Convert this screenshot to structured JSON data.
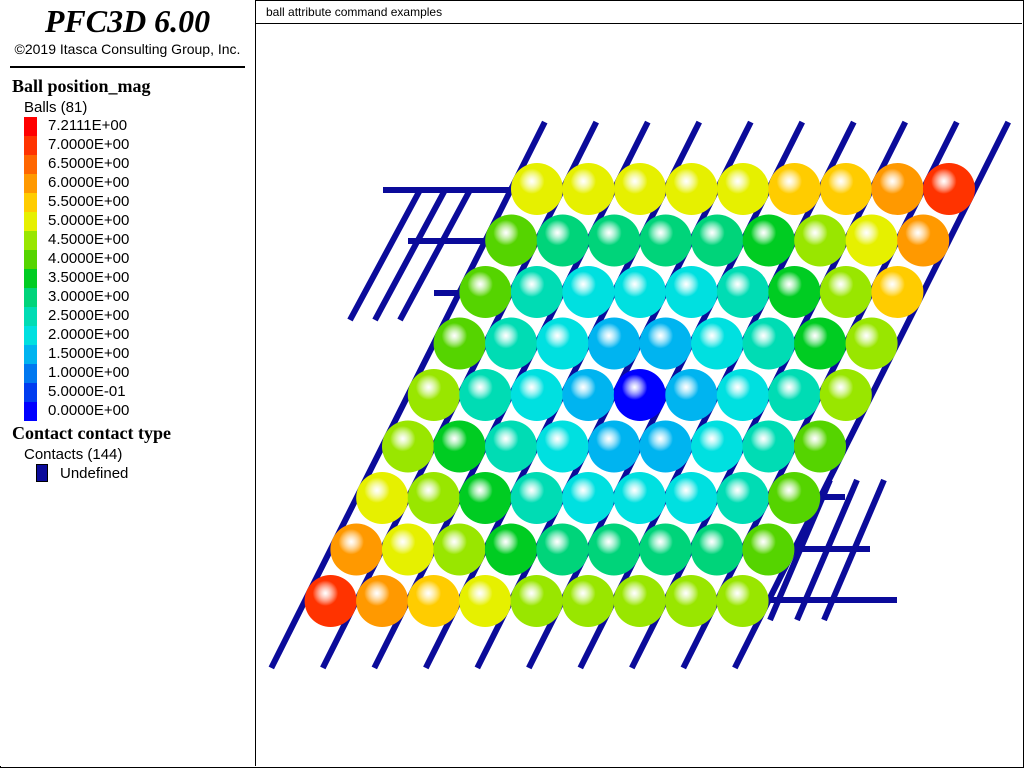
{
  "app": {
    "title": "PFC3D 6.00",
    "copyright": "©2019 Itasca Consulting Group, Inc."
  },
  "legend": {
    "ball_section": {
      "title": "Ball position_mag",
      "count_label": "Balls (81)",
      "color_entries": [
        {
          "label": "7.2111E+00",
          "color": "#ff0000"
        },
        {
          "label": "7.0000E+00",
          "color": "#ff3300"
        },
        {
          "label": "6.5000E+00",
          "color": "#ff6600"
        },
        {
          "label": "6.0000E+00",
          "color": "#ff9900"
        },
        {
          "label": "5.5000E+00",
          "color": "#ffcc00"
        },
        {
          "label": "5.0000E+00",
          "color": "#e6f000"
        },
        {
          "label": "4.5000E+00",
          "color": "#99e600"
        },
        {
          "label": "4.0000E+00",
          "color": "#55d400"
        },
        {
          "label": "3.5000E+00",
          "color": "#00cc22"
        },
        {
          "label": "3.0000E+00",
          "color": "#00d47a"
        },
        {
          "label": "2.5000E+00",
          "color": "#00dcb4"
        },
        {
          "label": "2.0000E+00",
          "color": "#00e0e0"
        },
        {
          "label": "1.5000E+00",
          "color": "#00b4f0"
        },
        {
          "label": "1.0000E+00",
          "color": "#0078f0"
        },
        {
          "label": "5.0000E-01",
          "color": "#003cf0"
        },
        {
          "label": "0.0000E+00",
          "color": "#0000ff"
        }
      ]
    },
    "contact_section": {
      "title": "Contact contact type",
      "count_label": "Contacts (144)",
      "entries": [
        {
          "label": "Undefined",
          "color": "#0b0b9a"
        }
      ]
    }
  },
  "plot": {
    "title": "ball attribute command examples",
    "ball_grid": {
      "rows": 9,
      "cols": 9,
      "position_mag": [
        [
          5.0,
          5.0,
          5.0,
          5.0,
          5.0,
          5.5,
          5.5,
          6.0,
          7.0
        ],
        [
          4.0,
          3.0,
          3.0,
          3.0,
          3.0,
          3.5,
          4.5,
          5.0,
          6.0
        ],
        [
          4.0,
          2.5,
          2.0,
          2.0,
          2.0,
          2.5,
          3.5,
          4.5,
          5.5
        ],
        [
          4.0,
          2.5,
          2.0,
          1.5,
          1.5,
          2.0,
          2.5,
          3.5,
          4.5
        ],
        [
          4.5,
          2.5,
          2.0,
          1.5,
          0.0,
          1.5,
          2.0,
          2.5,
          4.5
        ],
        [
          4.5,
          3.5,
          2.5,
          2.0,
          1.5,
          1.5,
          2.0,
          2.5,
          4.0
        ],
        [
          5.0,
          4.5,
          3.5,
          2.5,
          2.0,
          2.0,
          2.0,
          2.5,
          4.0
        ],
        [
          6.0,
          5.0,
          4.5,
          3.5,
          3.0,
          3.0,
          3.0,
          3.0,
          4.0
        ],
        [
          7.0,
          6.0,
          5.5,
          5.0,
          4.5,
          4.5,
          4.5,
          4.5,
          4.5
        ]
      ]
    }
  }
}
